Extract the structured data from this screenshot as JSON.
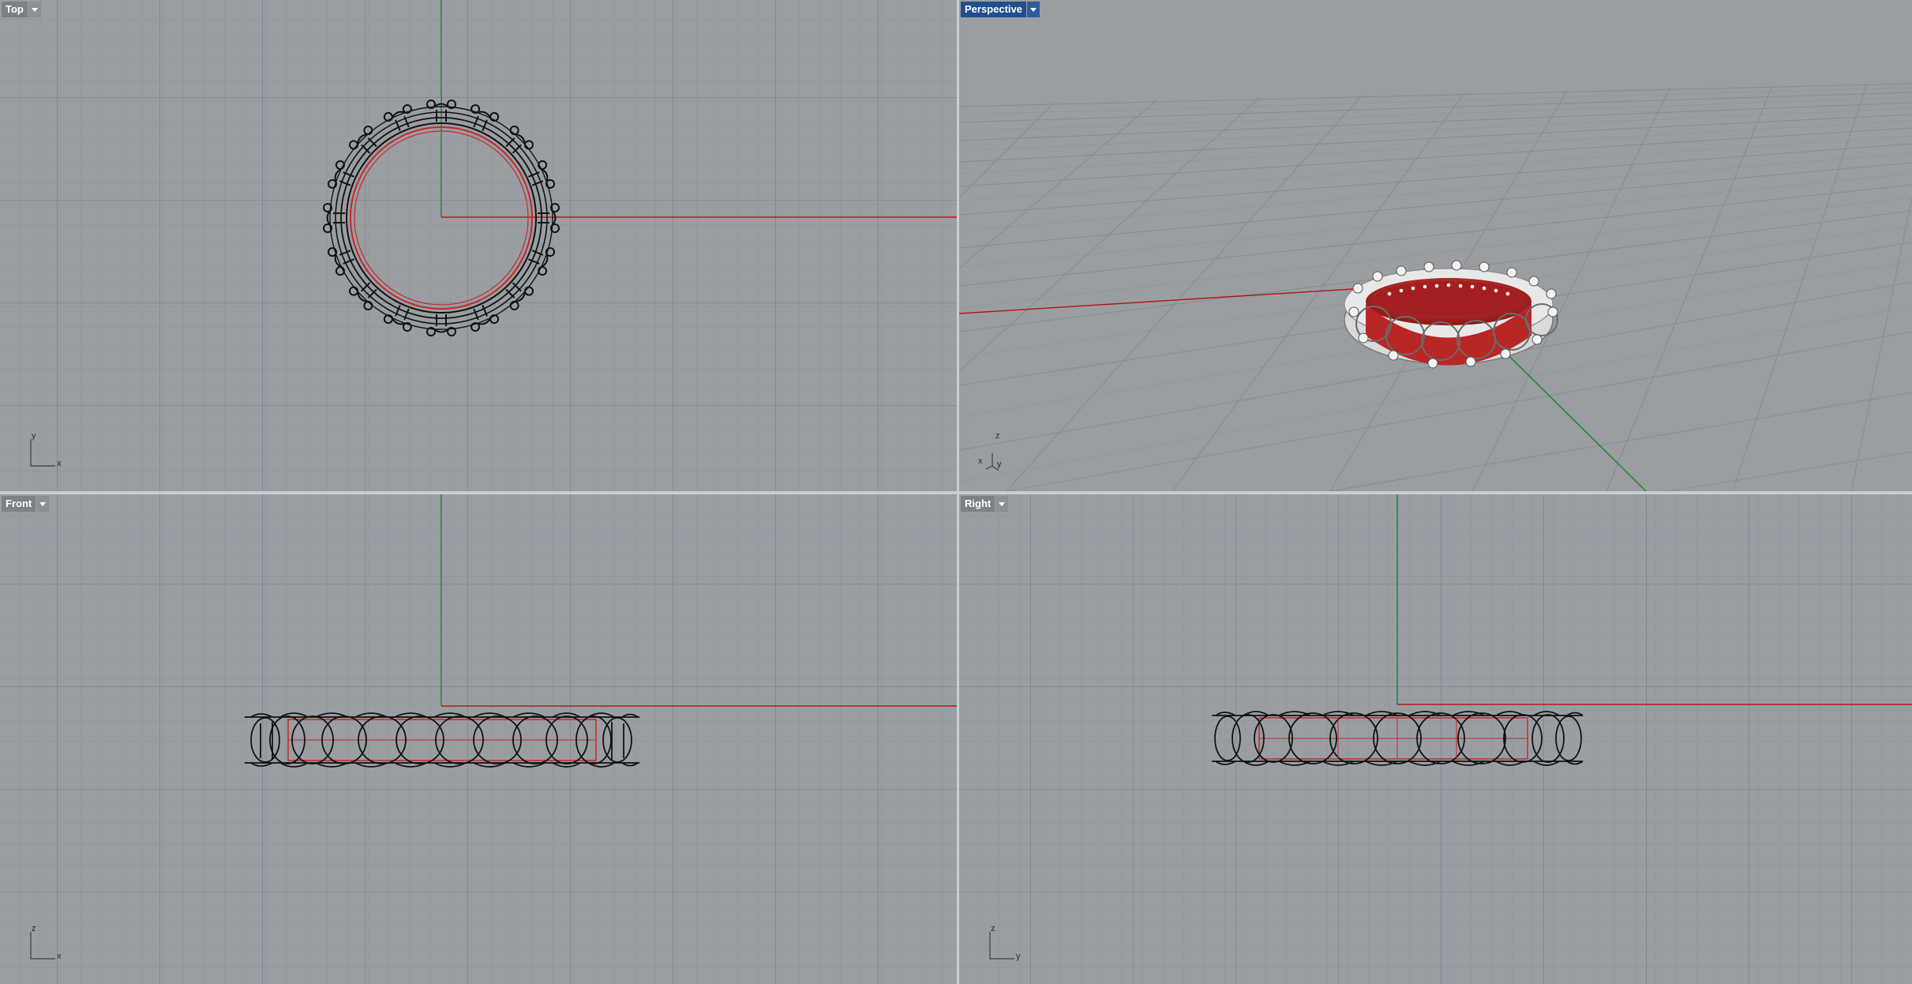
{
  "viewports": {
    "top": {
      "title": "Top",
      "axes": {
        "horizontal": "x",
        "vertical": "y"
      }
    },
    "perspective": {
      "title": "Perspective",
      "axes": {
        "a": "x",
        "b": "y",
        "c": "z"
      }
    },
    "front": {
      "title": "Front",
      "axes": {
        "horizontal": "x",
        "vertical": "z"
      }
    },
    "right": {
      "title": "Right",
      "axes": {
        "horizontal": "y",
        "vertical": "z"
      }
    }
  },
  "colors": {
    "viewport_bg": "#9a9ea3",
    "grid_minor": "#8f9398",
    "grid_major": "#7d8186",
    "x_axis": "#b11a1a",
    "y_axis": "#1d8a2a",
    "active_tab": "#1f4f8f",
    "ring_wire": "#0d0d0d",
    "ring_inner": "#c62828"
  },
  "icons": {
    "dropdown": "chevron-down-icon"
  }
}
